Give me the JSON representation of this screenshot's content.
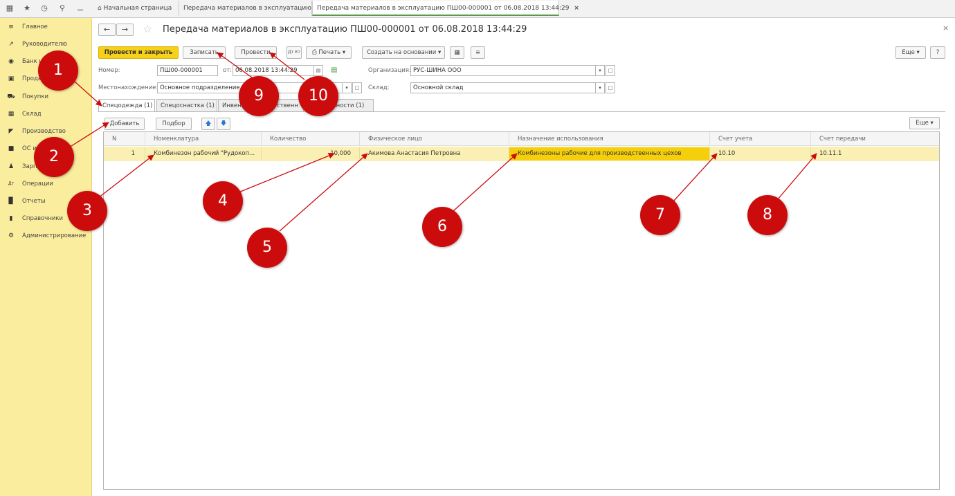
{
  "topbar": {
    "icons": [
      "apps-grid-icon",
      "star-icon",
      "history-icon",
      "search-icon",
      "bell-icon"
    ],
    "tabs": [
      {
        "label": "Начальная страница",
        "icon": "home-icon"
      },
      {
        "label": "Передача материалов в эксплуатацию"
      },
      {
        "label": "Передача материалов в эксплуатацию ПШ00-000001 от 06.08.2018 13:44:29"
      }
    ]
  },
  "sidebar": {
    "items": [
      {
        "label": "Главное",
        "icon": "menu-icon"
      },
      {
        "label": "Руководителю",
        "icon": "trend-icon"
      },
      {
        "label": "Банк и",
        "icon": "bank-icon"
      },
      {
        "label": "Прода",
        "icon": "bag-icon"
      },
      {
        "label": "Покупки",
        "icon": "cart-icon"
      },
      {
        "label": "Склад",
        "icon": "warehouse-icon"
      },
      {
        "label": "Производство",
        "icon": "factory-icon"
      },
      {
        "label": "ОС и",
        "icon": "truck-icon"
      },
      {
        "label": "Зарпл",
        "icon": "person-icon"
      },
      {
        "label": "Операции",
        "icon": "operations-icon"
      },
      {
        "label": "Отчеты",
        "icon": "bar-chart-icon"
      },
      {
        "label": "Справочники",
        "icon": "book-icon"
      },
      {
        "label": "Администрирование",
        "icon": "gear-icon"
      }
    ]
  },
  "form": {
    "title": "Передача материалов в эксплуатацию ПШ00-000001 от 06.08.2018 13:44:29",
    "close": "×",
    "toolbar": {
      "post_and_close": "Провести и закрыть",
      "save": "Записать",
      "post": "Провести",
      "dtkt": "Дт Кт",
      "print": "Печать",
      "create_based": "Создать на основании",
      "more": "Еще",
      "help": "?"
    },
    "fields": {
      "number_label": "Номер:",
      "number_value": "ПШ00-000001",
      "date_label": "от:",
      "date_value": "06.08.2018 13:44:29",
      "org_label": "Организация:",
      "org_value": "РУС-ШИНА ООО",
      "location_label": "Местонахождение:",
      "location_value": "Основное подразделение",
      "warehouse_label": "Склад:",
      "warehouse_value": "Основной склад"
    },
    "tabs": [
      {
        "label": "Спецодежда (1)"
      },
      {
        "label": "Спецоснастка (1)"
      },
      {
        "label": "Инвен"
      },
      {
        "label": "ственн"
      },
      {
        "label": "жности (1)"
      }
    ],
    "table_toolbar": {
      "add": "Добавить",
      "select": "Подбор",
      "more": "Еще"
    },
    "table": {
      "columns": [
        "N",
        "Номенклатура",
        "Количество",
        "Физическое лицо",
        "Назначение использования",
        "Счет учета",
        "Счет передачи"
      ],
      "rows": [
        [
          "1",
          "Комбинезон рабочий \"Рудокоп...",
          "10,000",
          "Акимова Анастасия Петровна",
          "Комбинезоны рабочие для производственных цехов",
          "10.10",
          "10.11.1"
        ]
      ]
    }
  },
  "markers": [
    "1",
    "2",
    "3",
    "4",
    "5",
    "6",
    "7",
    "8",
    "9",
    "10"
  ],
  "colors": {
    "sidebar": "#fbed9e",
    "primary_button": "#f7d117",
    "marker": "#cc0c0c",
    "row_highlight": "#fbf0b3",
    "cell_highlight": "#f5cf0c"
  }
}
